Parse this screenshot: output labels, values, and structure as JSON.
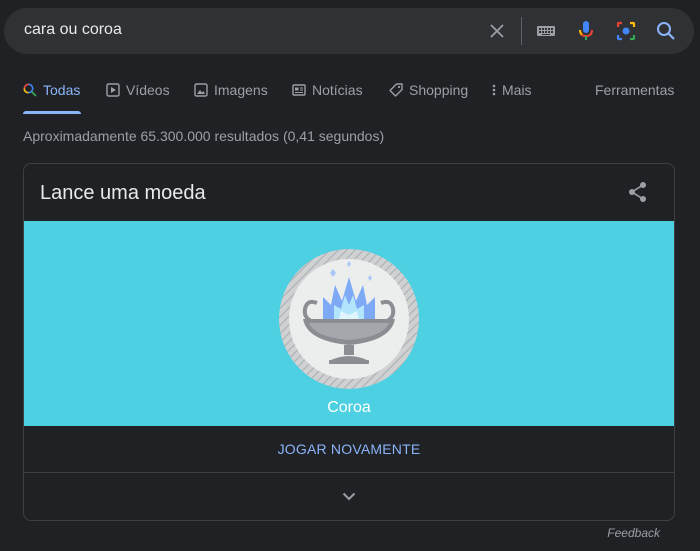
{
  "search": {
    "query": "cara ou coroa",
    "icons": [
      "close-icon",
      "keyboard-icon",
      "microphone-icon",
      "camera-lens-icon",
      "search-icon"
    ]
  },
  "tabs": [
    {
      "label": "Todas",
      "icon": "search-icon",
      "active": true
    },
    {
      "label": "Vídeos",
      "icon": "play-icon",
      "active": false
    },
    {
      "label": "Imagens",
      "icon": "image-icon",
      "active": false
    },
    {
      "label": "Notícias",
      "icon": "news-icon",
      "active": false
    },
    {
      "label": "Shopping",
      "icon": "tag-icon",
      "active": false
    },
    {
      "label": "Mais",
      "icon": "more-vertical-icon",
      "active": false
    }
  ],
  "tools_label": "Ferramentas",
  "result_stats": "Aproximadamente 65.300.000 resultados (0,41 segundos)",
  "card": {
    "title": "Lance uma moeda",
    "result": "Coroa",
    "replay_label": "JOGAR NOVAMENTE",
    "colors": {
      "coin_background": "#4dd0e1",
      "accent": "#8ab4f8"
    }
  },
  "feedback_label": "Feedback"
}
